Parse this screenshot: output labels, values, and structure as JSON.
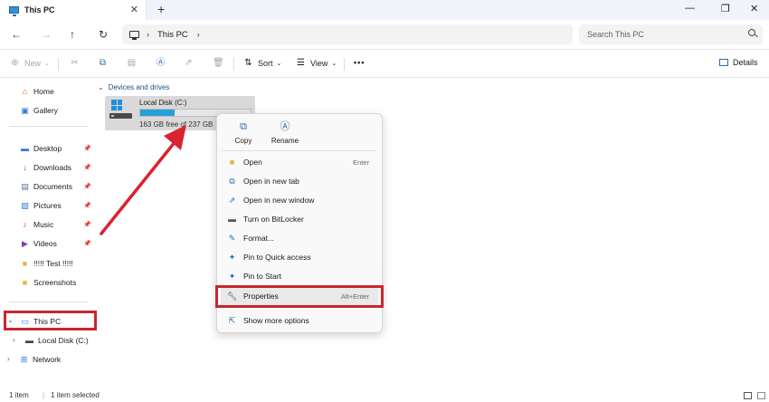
{
  "window": {
    "tab_title": "This PC",
    "tab_close": "✕",
    "new_tab": "+",
    "minimize": "—",
    "maximize": "❐",
    "close": "✕"
  },
  "nav": {
    "back": "←",
    "forward": "→",
    "up": "↑",
    "refresh": "↻",
    "breadcrumb": [
      "This PC"
    ],
    "search_placeholder": "Search This PC"
  },
  "toolbar": {
    "new_label": "New",
    "sort_label": "Sort",
    "view_label": "View",
    "more_label": "•••",
    "details_label": "Details"
  },
  "sidebar": {
    "items": [
      {
        "label": "Home",
        "icon": "home-icon",
        "pinned": false
      },
      {
        "label": "Gallery",
        "icon": "gallery-icon",
        "pinned": false
      },
      {
        "label": "Desktop",
        "icon": "desktop-icon",
        "pinned": true
      },
      {
        "label": "Downloads",
        "icon": "download-icon",
        "pinned": true
      },
      {
        "label": "Documents",
        "icon": "documents-icon",
        "pinned": true
      },
      {
        "label": "Pictures",
        "icon": "pictures-icon",
        "pinned": true
      },
      {
        "label": "Music",
        "icon": "music-icon",
        "pinned": true
      },
      {
        "label": "Videos",
        "icon": "videos-icon",
        "pinned": true
      },
      {
        "label": "!!!!! Test !!!!!",
        "icon": "folder-icon",
        "pinned": false
      },
      {
        "label": "Screenshots",
        "icon": "folder-icon",
        "pinned": false
      },
      {
        "label": "This PC",
        "icon": "pc-icon",
        "pinned": false
      },
      {
        "label": "Local Disk (C:)",
        "icon": "disk-icon",
        "pinned": false
      },
      {
        "label": "Network",
        "icon": "network-icon",
        "pinned": false
      }
    ]
  },
  "main": {
    "group_label": "Devices and drives",
    "drive": {
      "name": "Local Disk (C:)",
      "space": "163 GB free of 237 GB",
      "used_fraction": 0.31
    }
  },
  "context_menu": {
    "top_actions": [
      {
        "label": "Copy",
        "icon": "copy-icon"
      },
      {
        "label": "Rename",
        "icon": "rename-icon"
      }
    ],
    "items": [
      {
        "label": "Open",
        "shortcut": "Enter",
        "icon": "open-folder-icon"
      },
      {
        "label": "Open in new tab",
        "shortcut": "",
        "icon": "new-tab-icon"
      },
      {
        "label": "Open in new window",
        "shortcut": "",
        "icon": "new-window-icon"
      },
      {
        "label": "Turn on BitLocker",
        "shortcut": "",
        "icon": "bitlocker-icon"
      },
      {
        "label": "Format...",
        "shortcut": "",
        "icon": "format-icon"
      },
      {
        "label": "Pin to Quick access",
        "shortcut": "",
        "icon": "pin-icon"
      },
      {
        "label": "Pin to Start",
        "shortcut": "",
        "icon": "pin-icon"
      },
      {
        "label": "Properties",
        "shortcut": "Alt+Enter",
        "icon": "wrench-icon"
      },
      {
        "label": "Show more options",
        "shortcut": "",
        "icon": "more-options-icon"
      }
    ]
  },
  "status": {
    "count": "1 item",
    "selected": "1 item selected"
  },
  "colors": {
    "highlight_red": "#c8262f",
    "accent_blue": "#26a0da",
    "folder_yellow": "#e8b43a"
  }
}
